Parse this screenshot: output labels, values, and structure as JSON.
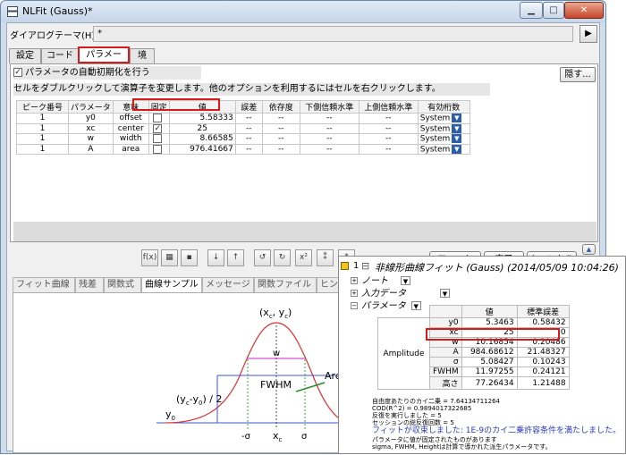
{
  "window": {
    "title": "NLFit (Gauss)*",
    "controls": {
      "minimize": "▁",
      "maximize": "□",
      "close": "✕"
    }
  },
  "theme": {
    "label": "ダイアログテーマ(H)",
    "value": "*",
    "arrow": "▶"
  },
  "tabs": [
    "設定",
    "コード",
    "パラメータ",
    "境界"
  ],
  "active_tab": "パラメータ",
  "param_panel": {
    "auto_init_label": "パラメータの自動初期化を行う",
    "auto_init_checked": "✓",
    "hide_button": "隠す...",
    "hint": "セルをダブルクリックして演算子を変更します。他のオプションを利用するにはセルを右クリックします。",
    "columns": [
      "ピーク番号",
      "パラメータ",
      "意味",
      "固定",
      "値",
      "誤差",
      "依存度",
      "下側信頼水準",
      "上側信頼水準",
      "有効桁数"
    ],
    "rows": [
      {
        "peak": "1",
        "param": "y0",
        "meaning": "offset",
        "fixed": "",
        "value": "5.58333",
        "error": "--",
        "dep": "--",
        "lcl": "--",
        "ucl": "--",
        "sig": "System"
      },
      {
        "peak": "1",
        "param": "xc",
        "meaning": "center",
        "fixed": "✓",
        "value": "25",
        "error": "--",
        "dep": "--",
        "lcl": "--",
        "ucl": "--",
        "sig": "System"
      },
      {
        "peak": "1",
        "param": "w",
        "meaning": "width",
        "fixed": "",
        "value": "8.66585",
        "error": "--",
        "dep": "--",
        "lcl": "--",
        "ucl": "--",
        "sig": "System"
      },
      {
        "peak": "1",
        "param": "A",
        "meaning": "area",
        "fixed": "",
        "value": "976.41667",
        "error": "--",
        "dep": "--",
        "lcl": "--",
        "ucl": "--",
        "sig": "System"
      }
    ]
  },
  "toolbar_icons": [
    "param-init-icon",
    "param-table-icon",
    "save-icon",
    "sort-down-icon",
    "sort-up-icon",
    "one-iteration-icon",
    "fit-until-converge-icon",
    "chi-square-icon",
    "simulate-icon",
    "peak-find-icon"
  ],
  "toolbar_glyphs": [
    "f(x)",
    "▦",
    "▪",
    "↓",
    "↑",
    "↺",
    "↻",
    "x²",
    "⁑",
    "⁂"
  ],
  "actions": {
    "fit": "フィット",
    "done": "完了",
    "cancel": "キャンセル",
    "collapse": "▲",
    "expand": "▼"
  },
  "bottom_tabs": [
    "フィット曲線",
    "残差",
    "関数式",
    "曲線サンプル",
    "メッセージ",
    "関数ファイル",
    "ヒント"
  ],
  "active_bottom_tab": "曲線サンプル",
  "sample_labels": {
    "xc_yc": "(x",
    "xc_sub": "c",
    "yc_mid": ", y",
    "yc_sub": "c",
    "close": ")",
    "w": "w",
    "fwhm": "FWHM",
    "area": "Area",
    "half_prefix": "(y",
    "half_sub_c": "c",
    "half_mid": "-y",
    "half_sub_0": "0",
    "half_suffix": ") / 2",
    "y0": "y",
    "y0_sub": "0",
    "neg_sigma": "-σ",
    "xc_axis": "x",
    "xc_axis_sub": "c",
    "sigma": "σ"
  },
  "result": {
    "number": "1",
    "collapse_sign": "⊟",
    "title": "非線形曲線フィット (Gauss) (2014/05/09 10:04:26)",
    "tree": [
      "ノート",
      "入力データ",
      "パラメータ"
    ],
    "table_headers": [
      "",
      "",
      "値",
      "標準誤差"
    ],
    "group_label": "Amplitude",
    "rows": [
      {
        "name": "y0",
        "value": "5.3463",
        "error": "0.58432"
      },
      {
        "name": "xc",
        "value": "25",
        "error": "0"
      },
      {
        "name": "w",
        "value": "10.16854",
        "error": "0.20486"
      },
      {
        "name": "A",
        "value": "984.68612",
        "error": "21.48327"
      },
      {
        "name": "σ",
        "value": "5.08427",
        "error": "0.10243"
      },
      {
        "name": "FWHM",
        "value": "11.97255",
        "error": "0.24121"
      },
      {
        "name": "高さ",
        "value": "77.26434",
        "error": "1.21488"
      }
    ],
    "notes": [
      "自由度あたりのカイ二乗 = 7.64134711264",
      "COD(R^2) = 0.9894017322685",
      "反復を実行しました = 5",
      "セッションの総反復回数 = 5"
    ],
    "converged": "フィットが収束しました:  1E-9のカイ二乗許容条件を満たしました。",
    "notes2": [
      "パラメータに値が固定されたものがあります",
      "sigma, FWHM, Heightは計算で導かれた派生パラメータです。"
    ]
  }
}
